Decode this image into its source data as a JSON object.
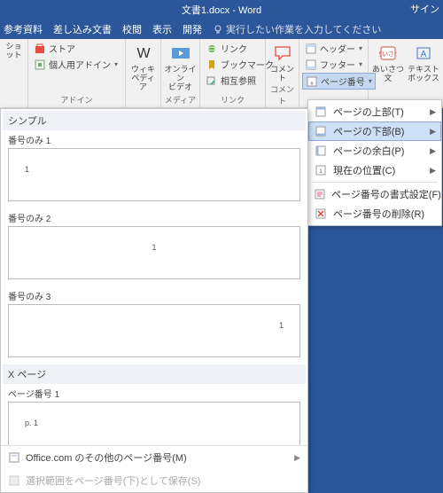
{
  "title": "文書1.docx  -  Word",
  "signin": "サイン",
  "tabs": {
    "ref": "参考資料",
    "mail": "差し込み文書",
    "review": "校閲",
    "view": "表示",
    "dev": "開発",
    "tell": "実行したい作業を入力してください"
  },
  "ribbon": {
    "shot": "ショット",
    "store": "ストア",
    "myaddins": "個人用アドイン",
    "addins": "アドイン",
    "wiki": "ウィキ\nペディア",
    "video": "オンライン\nビデオ",
    "media": "メディア",
    "link": "リンク",
    "bookmark": "ブックマーク",
    "crossref": "相互参照",
    "links": "リンク",
    "comment": "コメント",
    "comments": "コメント",
    "header": "ヘッダー",
    "footer": "フッター",
    "pagenum": "ページ番号",
    "greeting": "あいさつ\n文",
    "textbox": "テキスト\nボックス"
  },
  "submenu": {
    "top": "ページの上部(T)",
    "bottom": "ページの下部(B)",
    "margin": "ページの余白(P)",
    "current": "現在の位置(C)",
    "format": "ページ番号の書式設定(F)...",
    "remove": "ページ番号の削除(R)"
  },
  "gallery": {
    "simple": "シンプル",
    "only1": "番号のみ 1",
    "only2": "番号のみ 2",
    "only3": "番号のみ 3",
    "xpage": "X ページ",
    "pagenum1": "ページ番号 1",
    "thumb_p1": "p. 1",
    "office": "Office.com のその他のページ番号(M)",
    "savesel": "選択範囲をページ番号(下)として保存(S)"
  }
}
